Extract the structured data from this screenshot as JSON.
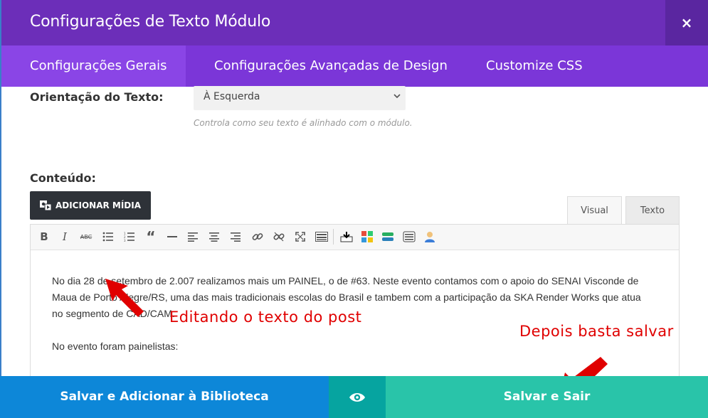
{
  "header": {
    "title": "Configurações de Texto Módulo",
    "close_label": "×"
  },
  "tabs": [
    {
      "label": "Configurações Gerais",
      "active": true
    },
    {
      "label": "Configurações Avançadas de Design",
      "active": false
    },
    {
      "label": "Customize CSS",
      "active": false
    }
  ],
  "orientation": {
    "label": "Orientação do Texto:",
    "value": "À Esquerda",
    "helper": "Controla como seu texto é alinhado com o módulo."
  },
  "content_section": {
    "label": "Conteúdo:",
    "media_button": "ADICIONAR MÍDIA",
    "editor_tabs": {
      "visual": "Visual",
      "texto": "Texto"
    },
    "paragraph1_line1": "No dia 28 de setembro de 2.007 realizamos mais um PAINEL, o de #63. Neste evento contamos com o apoio do SENAI Visconde de",
    "paragraph1_line2": "Maua de Porto Alegre/RS, uma das mais tradicionais escolas do Brasil e tambem com a participação da SKA Render Works que atua",
    "paragraph1_line3": "no segmento de CAD/CAM.",
    "paragraph2": "No evento foram painelistas:"
  },
  "annotations": {
    "edit": "Editando o texto do post",
    "save": "Depois basta salvar"
  },
  "footer": {
    "save_library": "Salvar e Adicionar à Biblioteca",
    "save_exit": "Salvar e Sair"
  },
  "colors": {
    "header": "#6c2eb9",
    "tabs": "#7b36d8",
    "tab_active": "#8a45e6",
    "library_button": "#0d87d8",
    "preview_button": "#06a4a0",
    "save_button": "#29c4a9",
    "annotation": "#e00000"
  },
  "toolbar_icons": [
    "bold-icon",
    "italic-icon",
    "strikethrough-icon",
    "bullet-list-icon",
    "numbered-list-icon",
    "blockquote-icon",
    "horizontal-rule-icon",
    "align-left-icon",
    "align-center-icon",
    "align-right-icon",
    "link-icon",
    "unlink-icon",
    "fullscreen-icon",
    "toolbar-toggle-icon",
    "upload-icon",
    "grid-icon",
    "layers-icon",
    "table-icon",
    "user-icon"
  ]
}
